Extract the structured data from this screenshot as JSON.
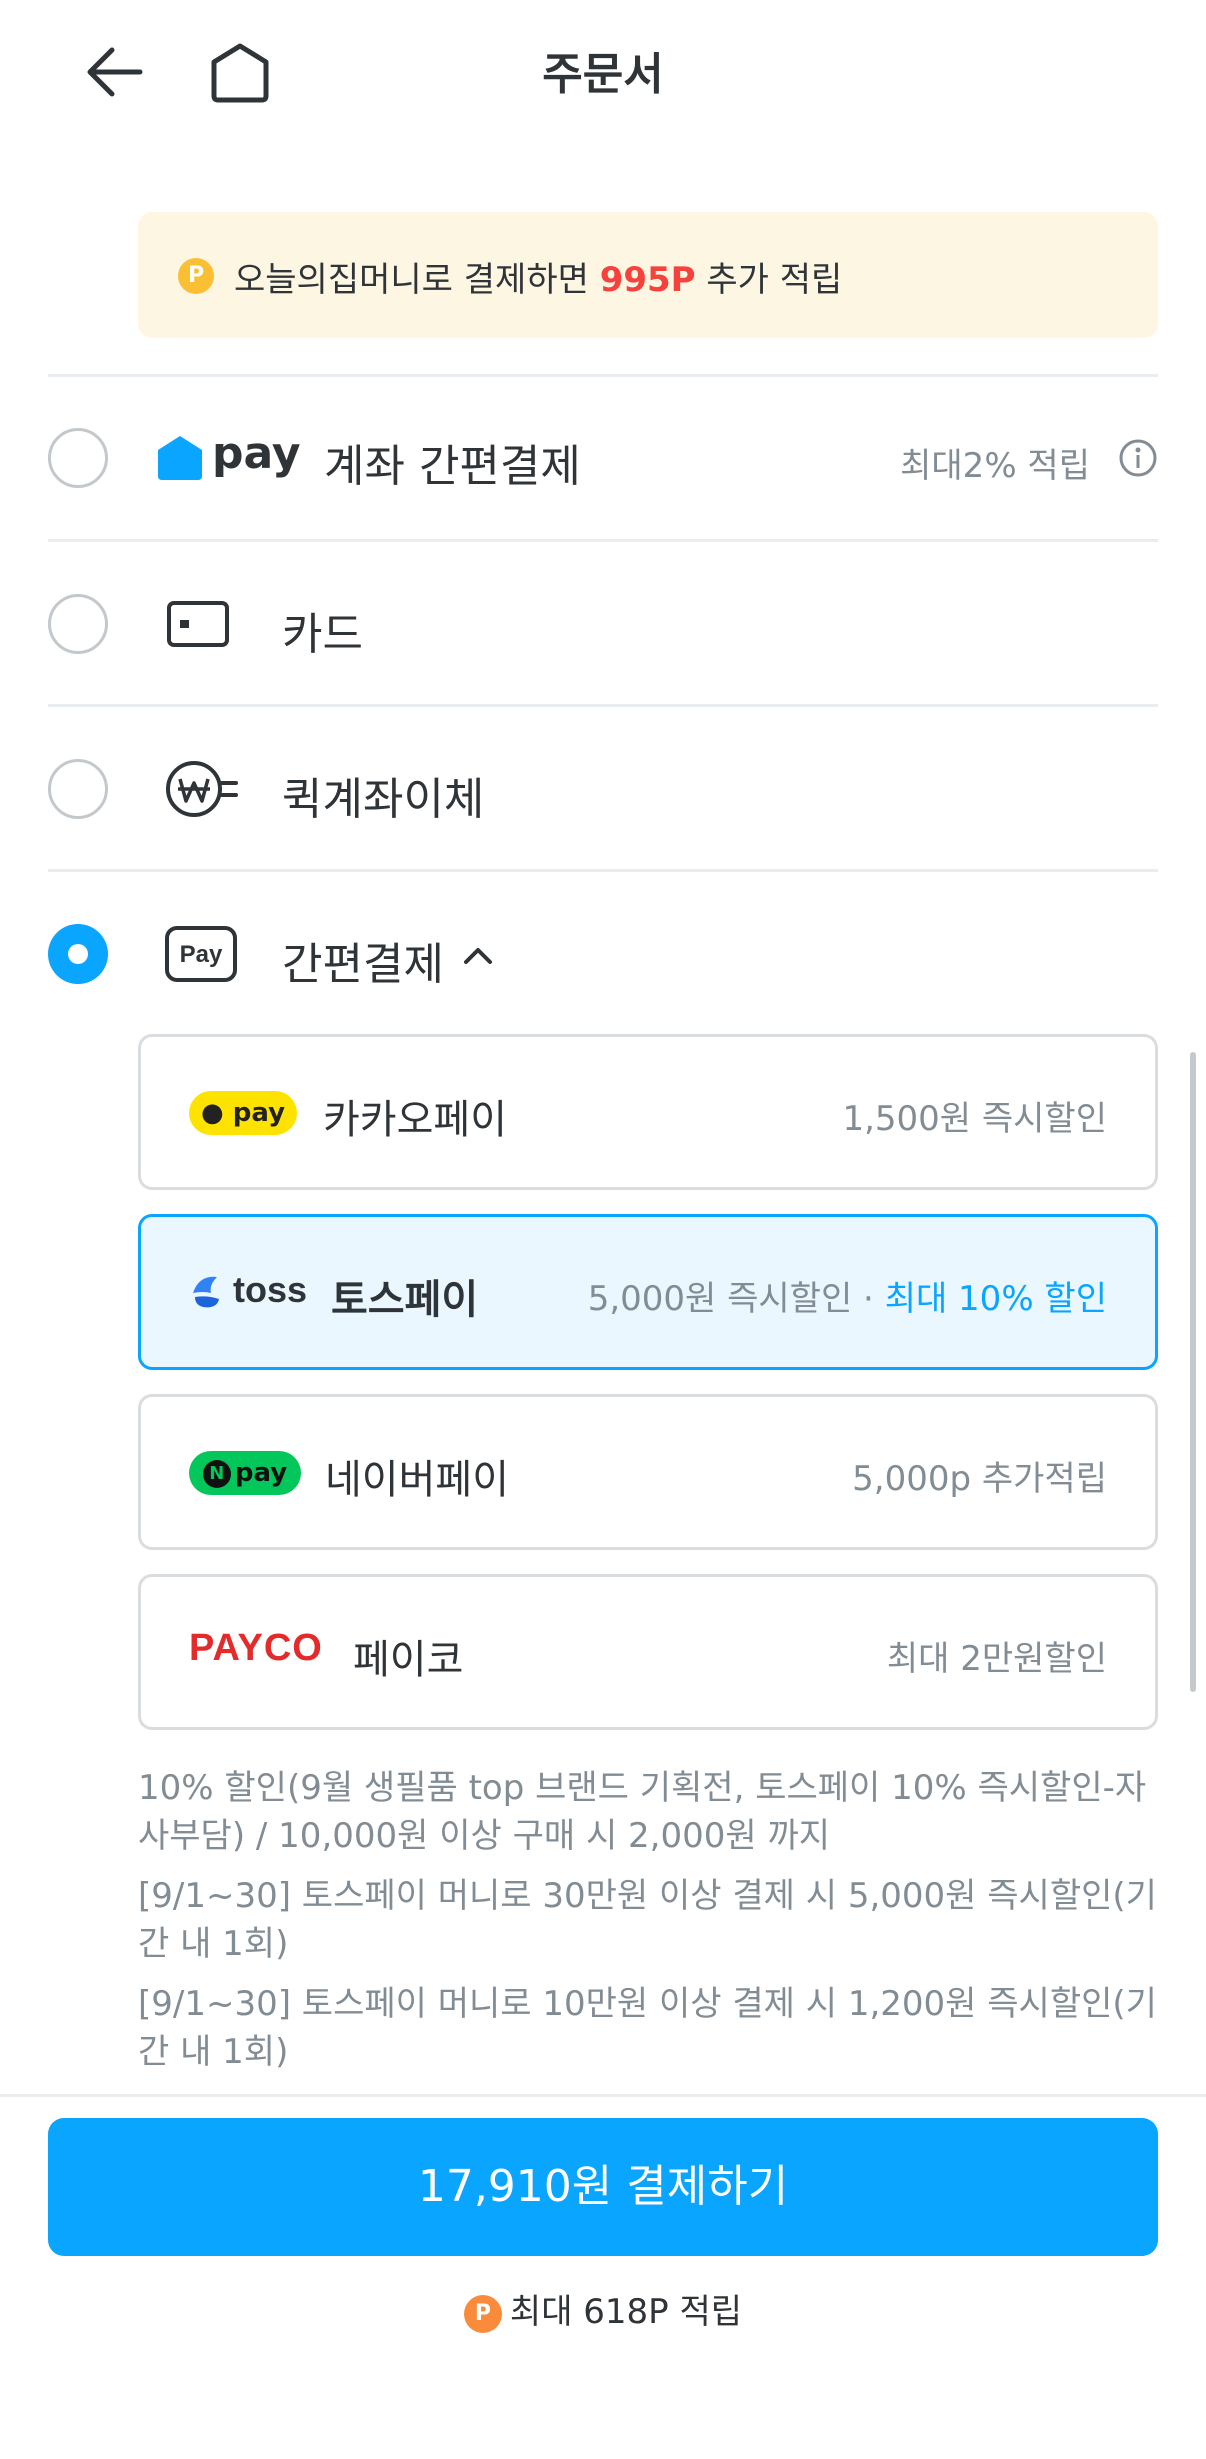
{
  "header": {
    "title": "주문서"
  },
  "notice": {
    "text_before": "오늘의집머니로 결제하면 ",
    "point": "995P",
    "text_after": " 추가 적립"
  },
  "methods": {
    "account": {
      "logo": "pay",
      "label": "계좌 간편결제",
      "aside": "최대2% 적립"
    },
    "card": {
      "label": "카드"
    },
    "quick": {
      "label": "퀵계좌이체"
    },
    "easy": {
      "label": "간편결제"
    }
  },
  "easy_pay": [
    {
      "logo": "pay",
      "name": "카카오페이",
      "aside": "1,500원 즉시할인"
    },
    {
      "logo": "toss",
      "name": "토스페이",
      "aside": "5,000원 즉시할인",
      "aside_sep": " · ",
      "aside_highlight": "최대 10% 할인"
    },
    {
      "logo": "pay",
      "name": "네이버페이",
      "aside": "5,000p 추가적립"
    },
    {
      "logo": "PAYCO",
      "name": "페이코",
      "aside": "최대 2만원할인"
    }
  ],
  "notes": [
    "10% 할인(9월 생필품 top 브랜드 기획전, 토스페이 10% 즉시할인-자사부담) / 10,000원 이상 구매 시 2,000원 까지",
    "[9/1~30] 토스페이 머니로 30만원 이상 결제 시 5,000원 즉시할인(기간 내 1회)",
    "[9/1~30] 토스페이 머니로 10만원 이상 결제 시 1,200원 즉시할인(기간 내 1회)"
  ],
  "footer": {
    "button": "17,910원 결제하기",
    "reward": "최대 618P 적립",
    "point_icon": "P"
  },
  "colors": {
    "accent": "#0aa5ff",
    "point_red": "#f5423c",
    "payco": "#e42b2b",
    "kakao": "#ffe300",
    "naver": "#03c75a"
  }
}
